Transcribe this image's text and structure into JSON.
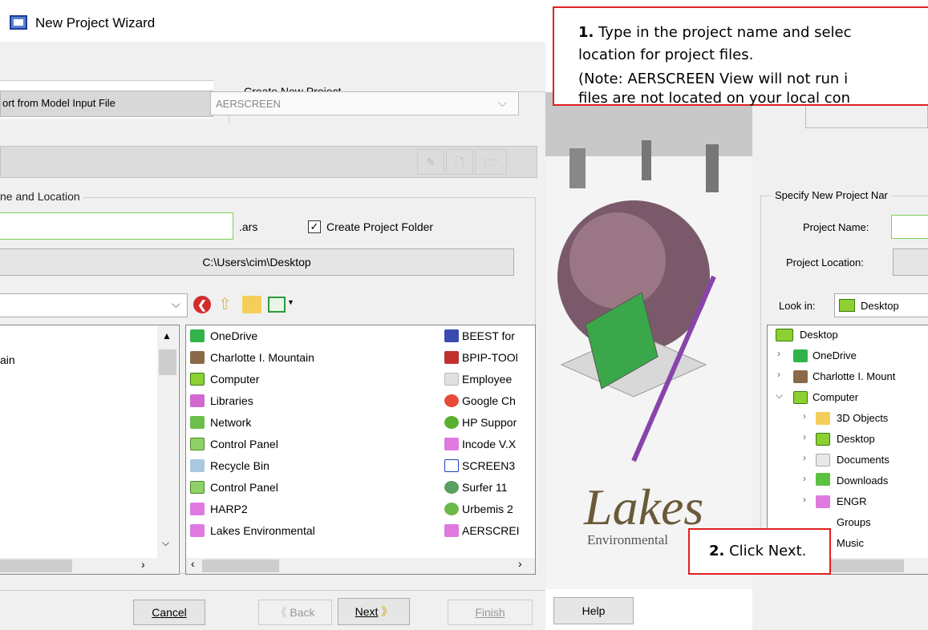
{
  "window": {
    "title": "New Project Wizard"
  },
  "left": {
    "create_group_label": "Create New Project",
    "tab_label": "ort from Model Input File",
    "model_combo_value": "AERSCREEN",
    "name_location_group": "ne and Location",
    "ext_label": ".ars",
    "create_folder_label": "Create Project Folder",
    "location_button": "C:\\Users\\cim\\Desktop",
    "tree_partial_item": "ain",
    "list_col1": [
      "OneDrive",
      "Charlotte I. Mountain",
      "Computer",
      "Libraries",
      "Network",
      "Control Panel",
      "Recycle Bin",
      "Control Panel",
      "HARP2",
      "Lakes Environmental"
    ],
    "list_col2": [
      "BEEST for",
      "BPIP-TOOl",
      "Employee",
      "Google Ch",
      "HP Suppor",
      "Incode V.X",
      "SCREEN3",
      "Surfer 11",
      "Urbemis 2",
      "AERSCREI"
    ]
  },
  "right": {
    "group_label": "Specify New Project Nar",
    "project_name_label": "Project Name:",
    "project_location_label": "Project Location:",
    "look_in_label": "Look in:",
    "look_in_value": "Desktop",
    "tree": [
      "Desktop",
      "OneDrive",
      "Charlotte I. Mount",
      "Computer",
      "3D Objects",
      "Desktop",
      "Documents",
      "Downloads",
      "ENGR",
      "Groups",
      "Music"
    ]
  },
  "buttons": {
    "cancel": "Cancel",
    "back": "Back",
    "next": "Next",
    "finish": "Finish",
    "help": "Help"
  },
  "center": {
    "logo_text": "Lakes",
    "logo_sub": "Environmental"
  },
  "callout1": {
    "num": "1.",
    "line1": " Type in the project name and selec",
    "line2": "location for project files.",
    "line3": "(Note: AERSCREEN View will not run i",
    "line4": "files are not located on your local con"
  },
  "callout2": {
    "num": "2.",
    "text": " Click Next."
  }
}
